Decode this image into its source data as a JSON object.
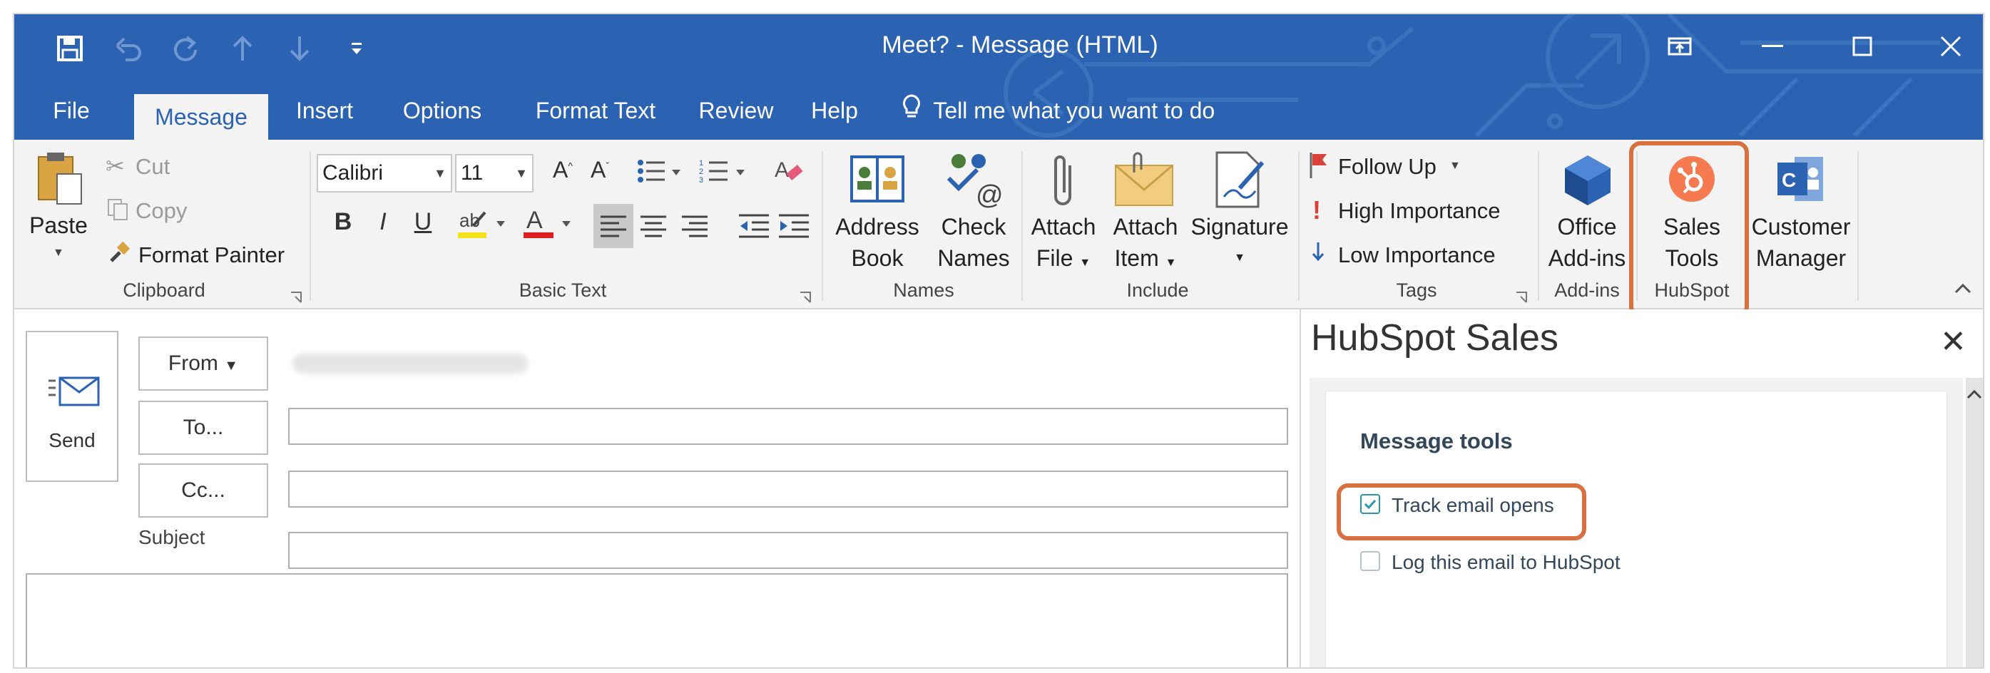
{
  "window": {
    "title": "Meet?  -  Message (HTML)"
  },
  "quick_access": {
    "icons": [
      "save-icon",
      "undo-icon",
      "redo-icon",
      "up-icon",
      "down-icon",
      "customize-icon"
    ]
  },
  "window_controls": [
    "ribbon-display-icon",
    "minimize-icon",
    "maximize-icon",
    "close-icon"
  ],
  "tabs": [
    {
      "label": "File"
    },
    {
      "label": "Message",
      "active": true
    },
    {
      "label": "Insert"
    },
    {
      "label": "Options"
    },
    {
      "label": "Format Text"
    },
    {
      "label": "Review"
    },
    {
      "label": "Help"
    }
  ],
  "tell_me": "Tell me what you want to do",
  "ribbon": {
    "clipboard": {
      "paste": "Paste",
      "cut": "Cut",
      "copy": "Copy",
      "format_painter": "Format Painter",
      "label": "Clipboard"
    },
    "basic_text": {
      "font": "Calibri",
      "size": "11",
      "bold": "B",
      "italic": "I",
      "underline": "U",
      "label": "Basic Text"
    },
    "names": {
      "address_book": [
        "Address",
        "Book"
      ],
      "check_names": [
        "Check",
        "Names"
      ],
      "label": "Names"
    },
    "include": {
      "attach_file": [
        "Attach",
        "File"
      ],
      "attach_item": [
        "Attach",
        "Item"
      ],
      "signature": "Signature",
      "label": "Include"
    },
    "tags": {
      "follow_up": "Follow Up",
      "high_importance": "High Importance",
      "low_importance": "Low Importance",
      "label": "Tags"
    },
    "addins": {
      "office_addins": [
        "Office",
        "Add-ins"
      ],
      "label": "Add-ins"
    },
    "hubspot": {
      "sales_tools": [
        "Sales",
        "Tools"
      ],
      "label": "HubSpot"
    },
    "customer_manager": [
      "Customer",
      "Manager"
    ]
  },
  "compose": {
    "send": "Send",
    "from": "From",
    "to": "To...",
    "cc": "Cc...",
    "subject": "Subject"
  },
  "pane": {
    "title": "HubSpot Sales",
    "section_title": "Message tools",
    "options": [
      {
        "label": "Track email opens",
        "checked": true
      },
      {
        "label": "Log this email to HubSpot",
        "checked": false
      }
    ]
  },
  "colors": {
    "title_bar": "#2b63b2",
    "ribbon_bg": "#f3f3f3",
    "callout": "#d97040",
    "hubspot_orange": "#f57a4f",
    "checkbox_accent": "#2a94b4"
  }
}
